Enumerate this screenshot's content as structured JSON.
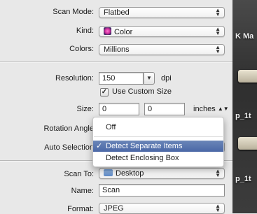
{
  "scan_mode": {
    "label": "Scan Mode:",
    "value": "Flatbed"
  },
  "kind": {
    "label": "Kind:",
    "value": "Color",
    "icon": "color-flower-icon"
  },
  "colors": {
    "label": "Colors:",
    "value": "Millions"
  },
  "resolution": {
    "label": "Resolution:",
    "value": "150",
    "unit": "dpi"
  },
  "custom_size": {
    "label": "Use Custom Size",
    "checked": true
  },
  "size": {
    "label": "Size:",
    "width": "0",
    "height": "0",
    "unit": "inches"
  },
  "rotation_angle": {
    "label": "Rotation Angle"
  },
  "auto_selection": {
    "label": "Auto Selection",
    "menu": [
      {
        "label": "Off",
        "selected": false
      },
      {
        "label": "Detect Separate Items",
        "selected": true
      },
      {
        "label": "Detect Enclosing Box",
        "selected": false
      }
    ]
  },
  "scan_to": {
    "label": "Scan To:",
    "value": "Desktop",
    "icon": "folder-icon"
  },
  "name": {
    "label": "Name:",
    "value": "Scan"
  },
  "format": {
    "label": "Format:",
    "value": "JPEG"
  },
  "desktop": {
    "frag1": "K Ma",
    "frag2": "p_1t",
    "frag3": "p_1t"
  },
  "colors_theme": {
    "selection": "#4a67a6"
  }
}
